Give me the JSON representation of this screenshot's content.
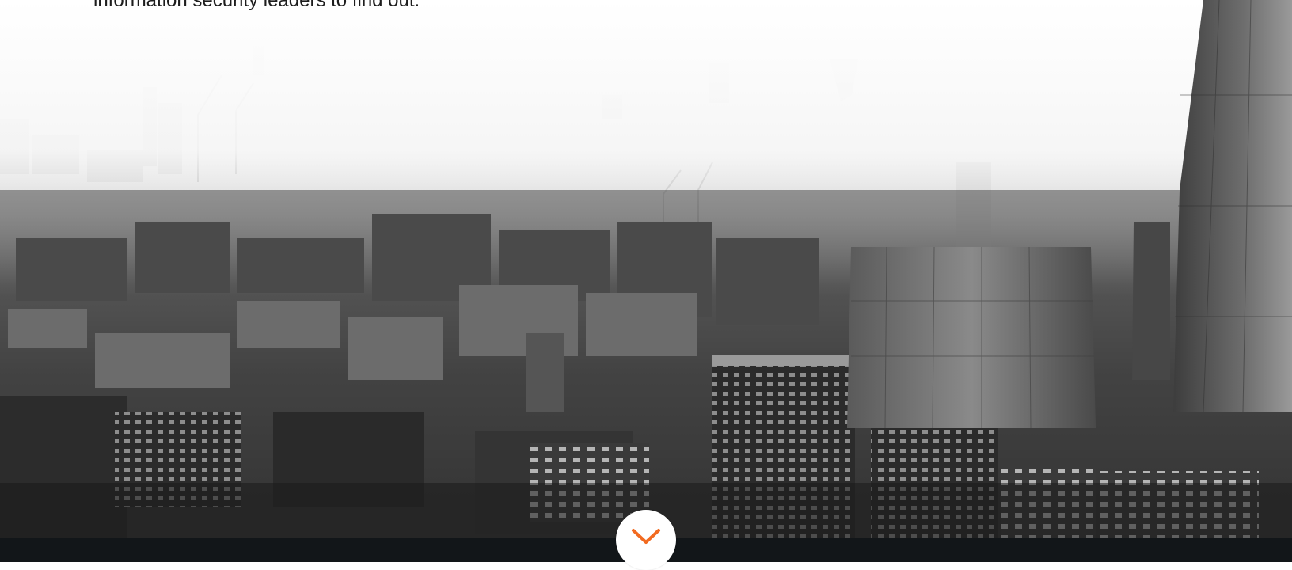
{
  "hero": {
    "text": "information security leaders to find out.",
    "image": {
      "icon": "city-skyline-photo"
    }
  },
  "scroll_button": {
    "icon": "chevron-down-icon",
    "color": "#f26b21"
  },
  "footer": {
    "color": "#121619"
  }
}
